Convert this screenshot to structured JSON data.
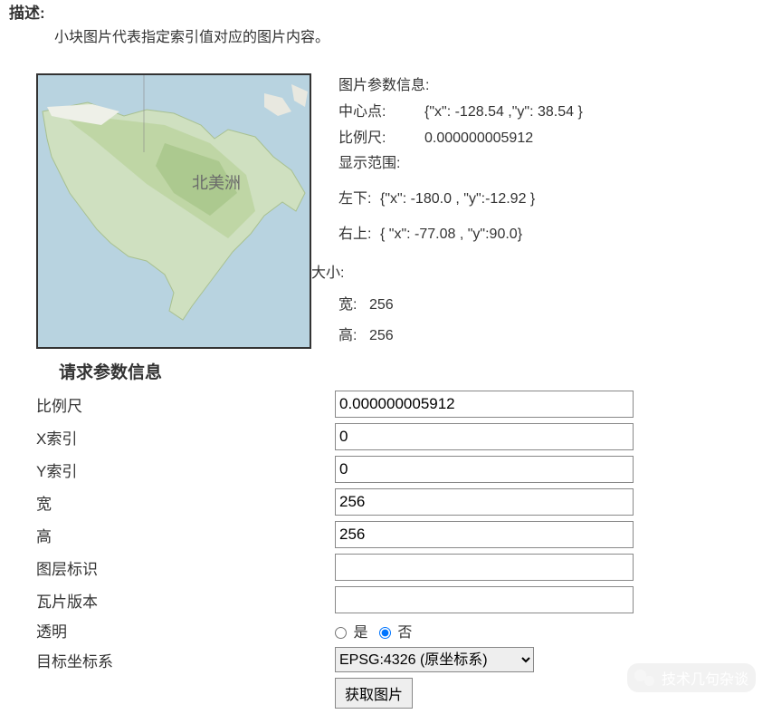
{
  "description": {
    "title": "描述:",
    "text": "小块图片代表指定索引值对应的图片内容。"
  },
  "map_label": "北美洲",
  "params": {
    "header": "图片参数信息:",
    "center_label": "中心点:",
    "center_value": "{\"x\": -128.54 ,\"y\": 38.54 }",
    "scale_label": "比例尺:",
    "scale_value": "0.000000005912",
    "extent_label": "显示范围:",
    "bl_label": "左下:",
    "bl_value": "{\"x\": -180.0 , \"y\":-12.92 }",
    "tr_label": "右上:",
    "tr_value": "{ \"x\": -77.08 , \"y\":90.0}",
    "size_label": "大小:",
    "width_label": "宽:",
    "width_value": "256",
    "height_label": "高:",
    "height_value": "256"
  },
  "form": {
    "header": "请求参数信息",
    "scale_label": "比例尺",
    "scale_value": "0.000000005912",
    "xindex_label": "X索引",
    "xindex_value": "0",
    "yindex_label": "Y索引",
    "yindex_value": "0",
    "width_label": "宽",
    "width_value": "256",
    "height_label": "高",
    "height_value": "256",
    "layer_label": "图层标识",
    "layer_value": "",
    "tile_label": "瓦片版本",
    "tile_value": "",
    "transparent_label": "透明",
    "yes": "是",
    "no": "否",
    "crs_label": "目标坐标系",
    "crs_option": "EPSG:4326 (原坐标系)",
    "submit": "获取图片"
  },
  "watermark": "技术几句杂谈"
}
